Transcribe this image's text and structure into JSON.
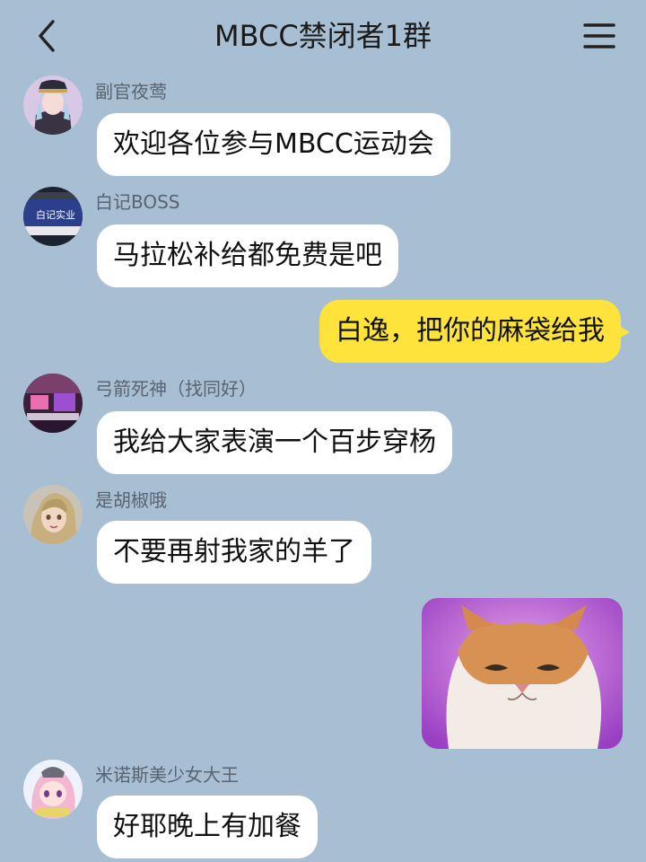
{
  "header": {
    "title": "MBCC禁闭者1群",
    "back_icon": "chevron-left-icon",
    "menu_icon": "hamburger-menu-icon"
  },
  "colors": {
    "background": "#a8bfd3",
    "incoming_bubble": "#ffffff",
    "outgoing_bubble": "#fde33c"
  },
  "messages": [
    {
      "sender": "副官夜莺",
      "text": "欢迎各位参与MBCC运动会",
      "direction": "incoming"
    },
    {
      "sender": "白记BOSS",
      "text": "马拉松补给都免费是吧",
      "direction": "incoming",
      "avatar_text": "白记实业"
    },
    {
      "sender": "",
      "text": "白逸，把你的麻袋给我",
      "direction": "outgoing"
    },
    {
      "sender": "弓箭死神（找同好）",
      "text": "我给大家表演一个百步穿杨",
      "direction": "incoming"
    },
    {
      "sender": "是胡椒哦",
      "text": "不要再射我家的羊了",
      "direction": "incoming"
    },
    {
      "sender": "",
      "image": "cat-meme-image",
      "direction": "outgoing"
    },
    {
      "sender": "米诺斯美少女大王",
      "text": "好耶晚上有加餐",
      "direction": "incoming"
    }
  ]
}
